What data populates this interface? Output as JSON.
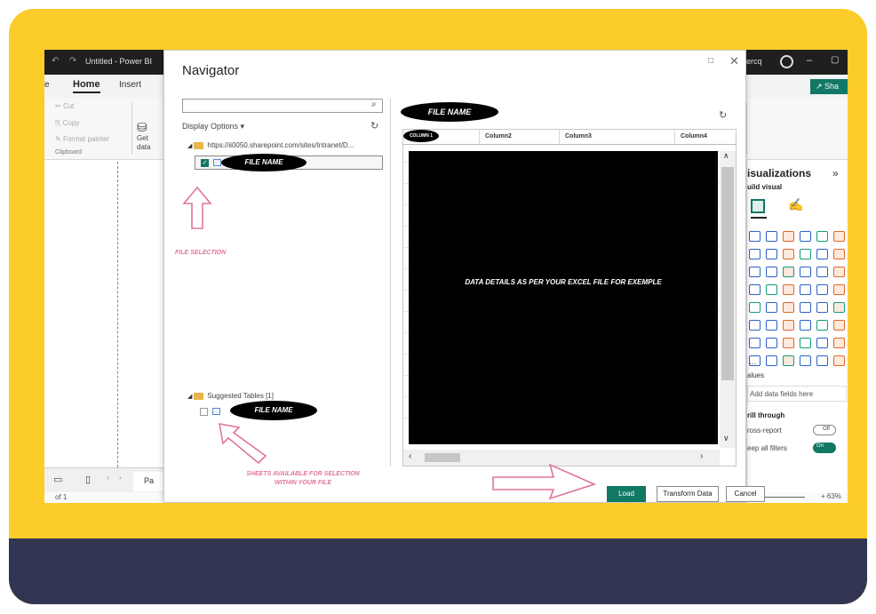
{
  "app": {
    "title": "Untitled - Power BI",
    "user_fragment": "ercq",
    "undo_icon": "undo-icon",
    "redo_icon": "redo-icon"
  },
  "ribbon": {
    "tab_partial": "e",
    "tabs": [
      "Home",
      "Insert"
    ],
    "share_label": "Sha",
    "cut": "Cut",
    "copy": "Copy",
    "format_painter": "Format painter",
    "clipboard": "Clipboard",
    "get_data": "Get data",
    "get_data_line1": "Get",
    "get_data_line2": "data"
  },
  "navigator": {
    "title": "Navigator",
    "search_value": "",
    "display_options": "Display Options",
    "display_options_arrow": "▾",
    "source_url": "https://ii0050.sharepoint.com/sites/Intranet/D...",
    "file_name_label": "FILE NAME",
    "file_selection_label": "FILE SELECTION",
    "suggested_tables": "Suggested Tables [1]",
    "sheets_label": "SHEETS AVAILABLE FOR SELECTION WITHIN YOUR FILE",
    "preview_header": "FILE NAME",
    "columns": [
      "COLUMN 1",
      "Column2",
      "Column3",
      "Column4"
    ],
    "data_details": "DATA DETAILS AS PER YOUR EXCEL FILE FOR EXEMPLE",
    "buttons": {
      "load": "Load",
      "transform": "Transform Data",
      "cancel": "Cancel"
    }
  },
  "visualizations": {
    "title": "isualizations",
    "build_visual": "uild visual",
    "values": "alues",
    "add_fields": "Add data fields here",
    "drill_through": "rill through",
    "cross_report": "ross-report",
    "cross_report_state": "Off",
    "keep_filters": "eep all filters",
    "keep_filters_state": "On",
    "more": "..."
  },
  "page": {
    "tab_partial": "Pa",
    "page_indicator": "of 1",
    "zoom": "63%",
    "zoom_sign": "+"
  },
  "colors": {
    "frame_yellow": "#fbcc2a",
    "frame_navy": "#323552",
    "pbi_green": "#117865",
    "annotation_pink": "#e0759a"
  }
}
